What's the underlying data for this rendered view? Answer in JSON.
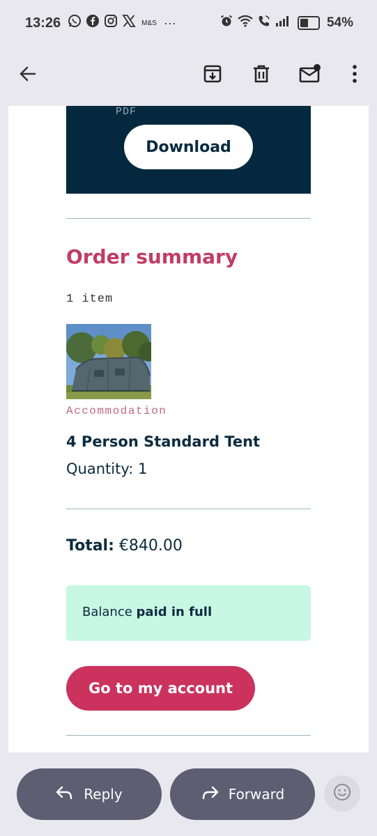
{
  "status_bar": {
    "time": "13:26",
    "notification_icons": [
      "whatsapp-icon",
      "facebook-icon",
      "instagram-icon",
      "x-icon"
    ],
    "carrier_text": "M&S",
    "more_text": "···",
    "battery_percent": "54%",
    "battery_level": 0.54
  },
  "toolbar": {
    "icons": [
      "back-arrow-icon",
      "archive-icon",
      "delete-icon",
      "mark-unread-icon",
      "more-vert-icon"
    ]
  },
  "email": {
    "pdf_label": "PDF",
    "download_label": "Download",
    "order_summary_title": "Order summary",
    "item_count": "1 item",
    "item": {
      "category": "Accommodation",
      "name": "4 Person Standard Tent",
      "quantity": "Quantity: 1"
    },
    "total_label": "Total:",
    "total_value": "€840.00",
    "balance_prefix": "Balance",
    "balance_status": "paid in full",
    "account_button": "Go to my account"
  },
  "bottom_bar": {
    "reply_label": "Reply",
    "forward_label": "Forward",
    "emoji_icon": "emoji-reaction-icon"
  },
  "colors": {
    "accent": "#cb325e",
    "title": "#c13c66",
    "dark_navy": "#04293f",
    "balance_bg": "#c8f7e4",
    "pill_bg": "#5d5e72"
  }
}
